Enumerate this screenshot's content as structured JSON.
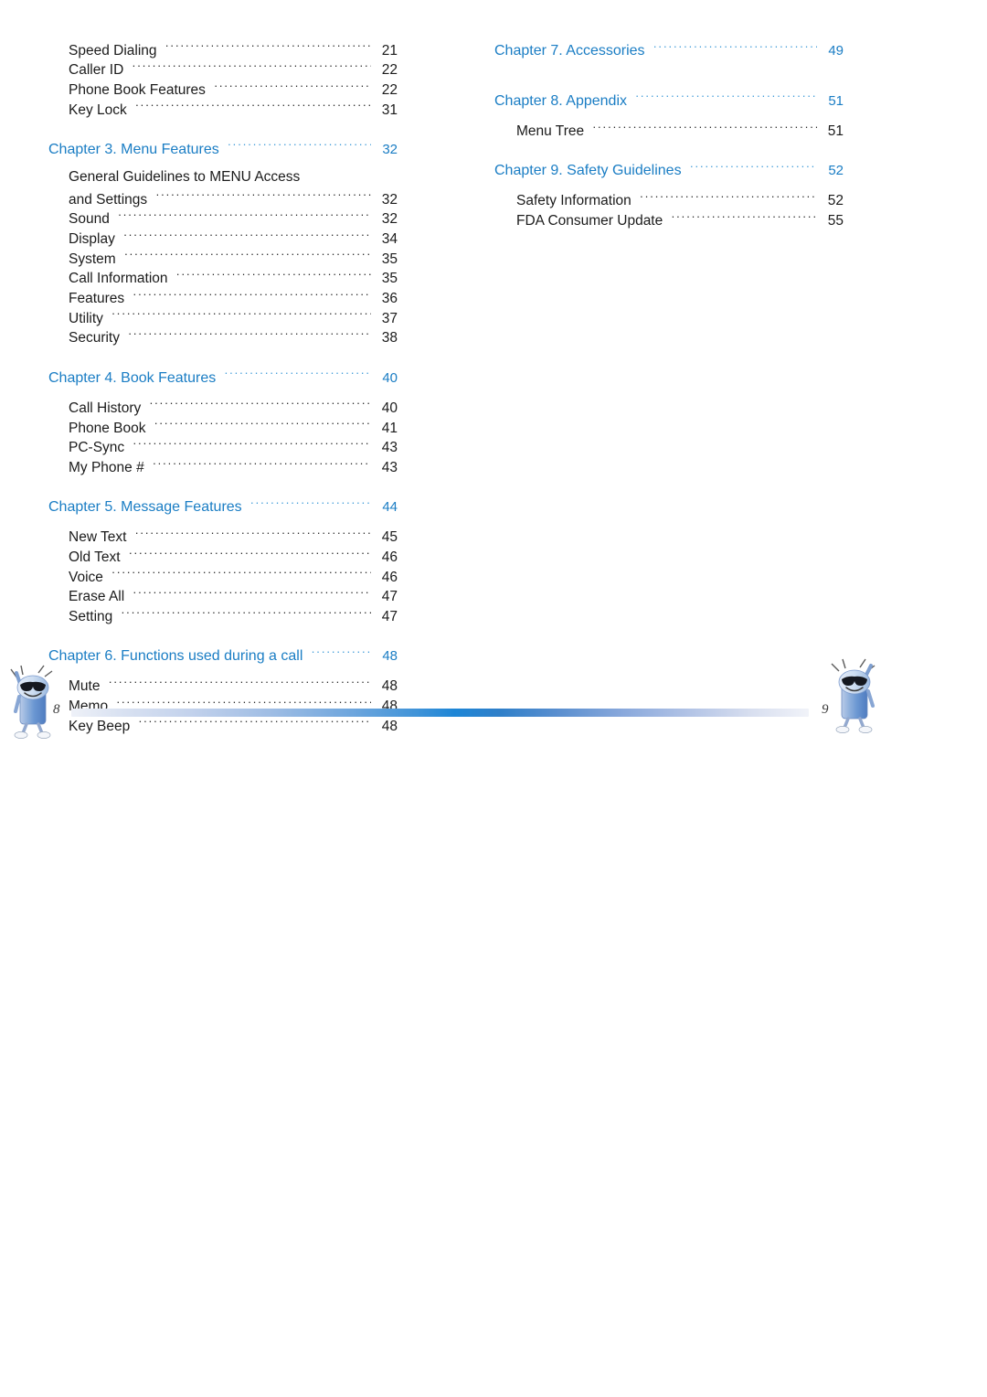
{
  "document": {
    "type": "table-of-contents",
    "left_page_number": "8",
    "right_page_number": "9",
    "accent_color": "#1a7dc4",
    "text_color": "#1b1b1b"
  },
  "left_column": {
    "entries": [
      {
        "kind": "entry",
        "label": "Speed Dialing",
        "page": "21"
      },
      {
        "kind": "entry",
        "label": "Caller ID",
        "page": "22"
      },
      {
        "kind": "entry",
        "label": "Phone Book Features",
        "page": "22"
      },
      {
        "kind": "entry",
        "label": "Key Lock",
        "page": "31"
      },
      {
        "kind": "chapter",
        "label": "Chapter 3.   Menu Features",
        "page": "32"
      },
      {
        "kind": "wrap",
        "label": "General Guidelines to MENU Access",
        "page": ""
      },
      {
        "kind": "entry",
        "label": "and Settings",
        "page": "32"
      },
      {
        "kind": "entry",
        "label": "Sound",
        "page": "32"
      },
      {
        "kind": "entry",
        "label": "Display",
        "page": "34"
      },
      {
        "kind": "entry",
        "label": "System",
        "page": "35"
      },
      {
        "kind": "entry",
        "label": "Call Information",
        "page": "35"
      },
      {
        "kind": "entry",
        "label": "Features",
        "page": "36"
      },
      {
        "kind": "entry",
        "label": "Utility",
        "page": "37"
      },
      {
        "kind": "entry",
        "label": "Security",
        "page": "38"
      },
      {
        "kind": "chapter",
        "label": "Chapter 4.   Book Features",
        "page": "40"
      },
      {
        "kind": "entry",
        "label": "Call History",
        "page": "40"
      },
      {
        "kind": "entry",
        "label": "Phone Book",
        "page": "41"
      },
      {
        "kind": "entry",
        "label": "PC-Sync",
        "page": "43"
      },
      {
        "kind": "entry",
        "label": "My Phone #",
        "page": "43"
      },
      {
        "kind": "chapter",
        "label": "Chapter 5.   Message Features",
        "page": "44"
      },
      {
        "kind": "entry",
        "label": "New Text",
        "page": "45"
      },
      {
        "kind": "entry",
        "label": "Old Text",
        "page": "46"
      },
      {
        "kind": "entry",
        "label": "Voice",
        "page": "46"
      },
      {
        "kind": "entry",
        "label": "Erase All",
        "page": "47"
      },
      {
        "kind": "entry",
        "label": "Setting",
        "page": "47"
      },
      {
        "kind": "chapter",
        "label": "Chapter 6.   Functions used during a call",
        "page": "48"
      },
      {
        "kind": "entry",
        "label": "Mute",
        "page": "48"
      },
      {
        "kind": "entry",
        "label": "Memo",
        "page": "48"
      },
      {
        "kind": "entry",
        "label": "Key Beep",
        "page": "48"
      }
    ]
  },
  "right_column": {
    "entries": [
      {
        "kind": "chapter",
        "label": "Chapter 7.   Accessories",
        "page": "49"
      },
      {
        "kind": "chapter",
        "label": "Chapter 8.   Appendix",
        "page": "51"
      },
      {
        "kind": "entry",
        "label": "Menu Tree",
        "page": "51"
      },
      {
        "kind": "chapter",
        "label": "Chapter 9.   Safety Guidelines",
        "page": "52"
      },
      {
        "kind": "entry",
        "label": "Safety Information",
        "page": "52"
      },
      {
        "kind": "entry",
        "label": "FDA Consumer Update",
        "page": "55"
      }
    ]
  },
  "mascots": {
    "left_name": "phone-mascot-left",
    "right_name": "phone-mascot-right"
  }
}
